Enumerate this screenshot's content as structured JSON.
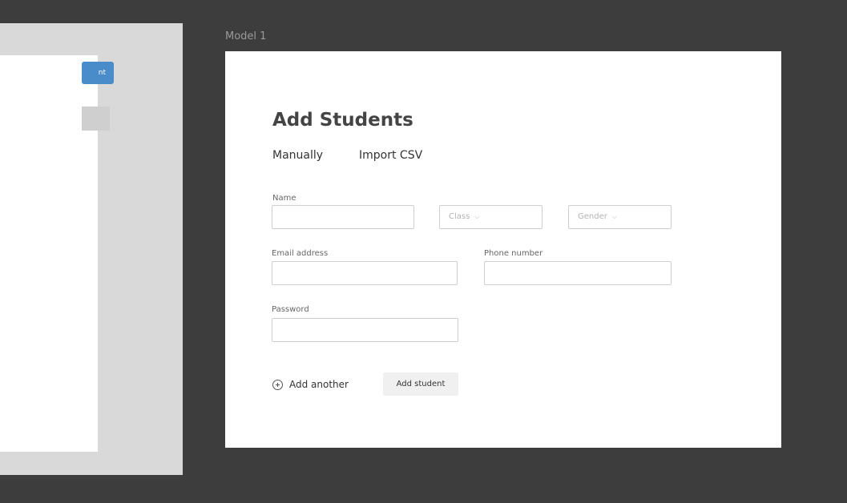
{
  "left_frame": {
    "button_label": "nt"
  },
  "frame_label": "Model 1",
  "form": {
    "title": "Add Students",
    "tabs": [
      {
        "label": "Manually"
      },
      {
        "label": "Import CSV"
      }
    ],
    "fields": {
      "name": {
        "label": "Name",
        "value": ""
      },
      "class": {
        "placeholder": "Class"
      },
      "gender": {
        "placeholder": "Gender"
      },
      "email": {
        "label": "Email address",
        "value": ""
      },
      "phone": {
        "label": "Phone number",
        "value": ""
      },
      "password": {
        "label": "Password",
        "value": ""
      }
    },
    "add_another_label": "Add another",
    "add_student_label": "Add student",
    "icons": {
      "add_another": "plus-circle-icon",
      "dropdown": "chevron-down-icon"
    }
  },
  "colors": {
    "canvas_bg": "#3d3d3d",
    "artboard_bg": "#ffffff",
    "accent": "#4a8bc9"
  }
}
